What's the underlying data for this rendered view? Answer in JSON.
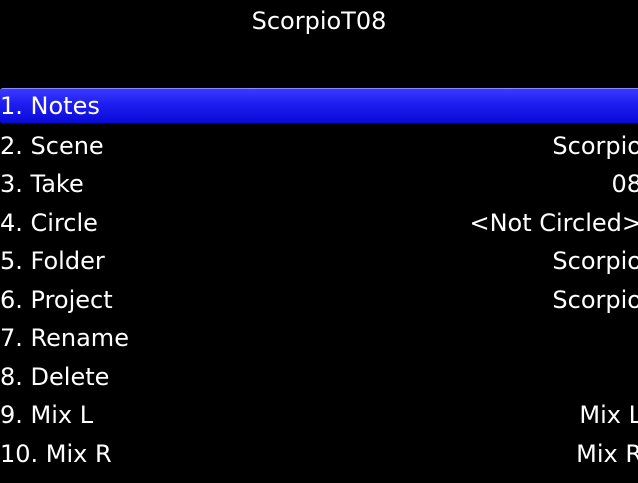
{
  "header": {
    "title": "ScorpioT08"
  },
  "menu": {
    "items": [
      {
        "label": "1. Notes",
        "value": "",
        "selected": true
      },
      {
        "label": "2. Scene",
        "value": "Scorpio"
      },
      {
        "label": "3. Take",
        "value": "08"
      },
      {
        "label": "4. Circle",
        "value": "<Not Circled>"
      },
      {
        "label": "5. Folder",
        "value": "Scorpio"
      },
      {
        "label": "6. Project",
        "value": "Scorpio"
      },
      {
        "label": "7. Rename",
        "value": ""
      },
      {
        "label": "8. Delete",
        "value": ""
      },
      {
        "label": "9. Mix L",
        "value": "Mix L"
      },
      {
        "label": "10. Mix R",
        "value": "Mix R"
      }
    ]
  },
  "colors": {
    "background": "#000000",
    "text": "#ffffff",
    "selection": "#1d1df0"
  }
}
